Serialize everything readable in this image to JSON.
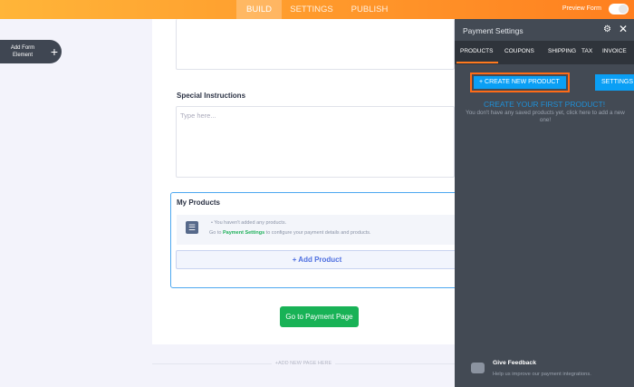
{
  "topbar": {
    "tabs": [
      {
        "label": "BUILD"
      },
      {
        "label": "SETTINGS"
      },
      {
        "label": "PUBLISH"
      }
    ],
    "preview_label": "Preview Form"
  },
  "sidebar": {
    "add_element_label": "Add Form Element",
    "plus": "+"
  },
  "form": {
    "special_label": "Special Instructions",
    "special_placeholder": "Type here...",
    "products": {
      "title": "My Products",
      "note1": "• You haven't added any products.",
      "note2_pre": "Go to ",
      "note2_link": "Payment Settings",
      "note2_post": " to configure your payment details and products.",
      "add_label": "+ Add Product"
    },
    "go_payment": "Go to Payment Page",
    "add_page": "+ADD NEW PAGE HERE"
  },
  "panel": {
    "title": "Payment Settings",
    "tabs": [
      {
        "label": "PRODUCTS"
      },
      {
        "label": "COUPONS"
      },
      {
        "label": "SHIPPING"
      },
      {
        "label": "TAX"
      },
      {
        "label": "INVOICE"
      }
    ],
    "create_label": "+ CREATE NEW PRODUCT",
    "settings_label": "SETTINGS",
    "empty_title": "CREATE YOUR FIRST PRODUCT!",
    "empty_sub": "You don't have any saved products yet, click here to add a new one!",
    "feedback_title": "Give Feedback",
    "feedback_sub": "Help us improve our payment integrations."
  },
  "colors": {
    "accent": "#ff7a1f",
    "blue": "#0a9ff5",
    "green": "#18b256"
  }
}
